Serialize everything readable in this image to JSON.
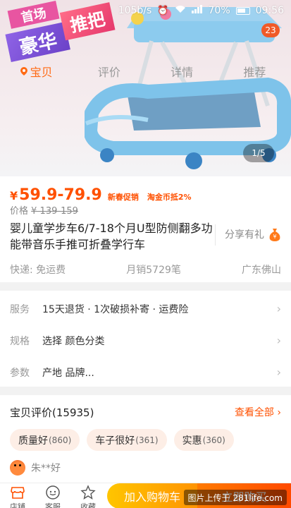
{
  "status_bar": {
    "speed": "105b/s",
    "battery": "70%",
    "time": "09:56"
  },
  "promo_badge": {
    "line0": "首场",
    "word1": "豪华",
    "word2": "推把"
  },
  "cart_count": "23",
  "nav_tabs": [
    {
      "label": "宝贝",
      "active": true
    },
    {
      "label": "评价",
      "active": false
    },
    {
      "label": "详情",
      "active": false
    },
    {
      "label": "推荐",
      "active": false
    }
  ],
  "image_indicator": "1/5",
  "price": {
    "currency": "¥",
    "range": "59.9-79.9",
    "tag1": "新春促销",
    "tag2": "淘金币抵2%",
    "orig_label": "价格",
    "orig_value": "¥ 139-159"
  },
  "product_title": "婴儿童学步车6/7-18个月U型防侧翻多功能带音乐手推可折叠学行车",
  "share_label": "分享有礼",
  "meta": {
    "shipping": "快递: 免运费",
    "sales": "月销5729笔",
    "location": "广东佛山"
  },
  "options": [
    {
      "key": "服务",
      "value": "15天退货 · 1次破损补寄 · 运费险"
    },
    {
      "key": "规格",
      "value": "选择 颜色分类"
    },
    {
      "key": "参数",
      "value": "产地 品牌..."
    }
  ],
  "reviews": {
    "title": "宝贝评价(15935)",
    "view_all": "查看全部 ",
    "chips": [
      {
        "label": "质量好",
        "count": "(860)"
      },
      {
        "label": "车子很好",
        "count": "(361)"
      },
      {
        "label": "实惠",
        "count": "(360)"
      }
    ],
    "reviewer": "朱**好"
  },
  "bottom_bar": {
    "store": "店铺",
    "service": "客服",
    "favorite": "收藏",
    "add_to_cart": "加入购物车",
    "buy_now": "立即购买"
  },
  "watermark": "图片上传于 281life.com",
  "colors": {
    "accent": "#ff5000",
    "cart_gradient": [
      "#ffc500",
      "#ff9402"
    ],
    "buy_gradient": [
      "#ff7a00",
      "#ff4a00"
    ]
  }
}
